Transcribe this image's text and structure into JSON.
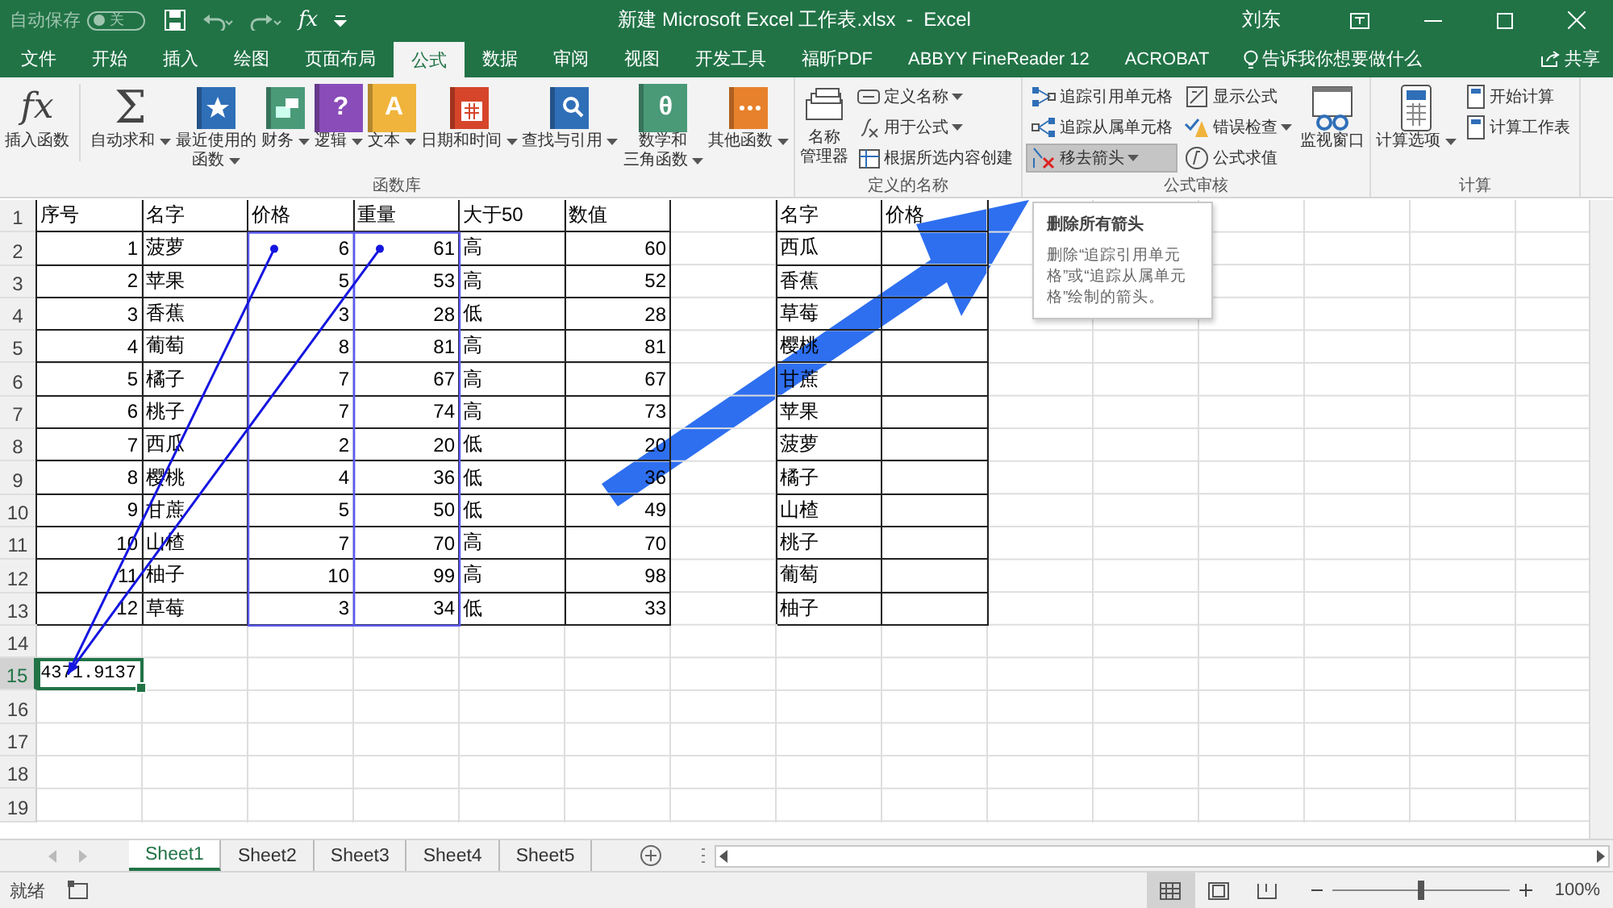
{
  "title_bar": {
    "autosave": {
      "label": "自动保存",
      "on": false,
      "state_label": "关"
    },
    "quick_access_glyph": "fx",
    "title": "新建 Microsoft Excel 工作表.xlsx  -  Excel",
    "user": "刘东"
  },
  "tabs": [
    {
      "label": "文件",
      "selected": false
    },
    {
      "label": "开始",
      "selected": false
    },
    {
      "label": "插入",
      "selected": false
    },
    {
      "label": "绘图",
      "selected": false
    },
    {
      "label": "页面布局",
      "selected": false
    },
    {
      "label": "公式",
      "selected": true
    },
    {
      "label": "数据",
      "selected": false
    },
    {
      "label": "审阅",
      "selected": false
    },
    {
      "label": "视图",
      "selected": false
    },
    {
      "label": "开发工具",
      "selected": false
    },
    {
      "label": "福昕PDF",
      "selected": false
    },
    {
      "label": "ABBYY FineReader 12",
      "selected": false
    },
    {
      "label": "ACROBAT",
      "selected": false
    }
  ],
  "tell_me": "告诉我你想要做什么",
  "share": "共享",
  "ribbon": {
    "function_library": {
      "label": "函数库",
      "buttons": [
        {
          "glyph": "fx",
          "lines": [
            "插入函数"
          ],
          "dropdown": false
        },
        {
          "glyph": "Σ",
          "lines": [
            "自动求和"
          ],
          "dropdown": true
        },
        {
          "lines": [
            "最近使用的",
            "函数"
          ],
          "dropdown": true
        },
        {
          "lines": [
            "财务"
          ],
          "dropdown": true
        },
        {
          "glyph": "?",
          "lines": [
            "逻辑"
          ],
          "dropdown": true
        },
        {
          "glyph": "A",
          "lines": [
            "文本"
          ],
          "dropdown": true
        },
        {
          "lines": [
            "日期和时间"
          ],
          "dropdown": true
        },
        {
          "lines": [
            "查找与引用"
          ],
          "dropdown": true
        },
        {
          "glyph": "θ",
          "lines": [
            "数学和",
            "三角函数"
          ],
          "dropdown": true
        },
        {
          "lines": [
            "其他函数"
          ],
          "dropdown": true
        }
      ]
    },
    "defined_names": {
      "label": "定义的名称",
      "large": {
        "lines": [
          "名称",
          "管理器"
        ]
      },
      "items": [
        {
          "label": "定义名称",
          "dropdown": true
        },
        {
          "label": "用于公式",
          "dropdown": true
        },
        {
          "label": "根据所选内容创建",
          "dropdown": false
        }
      ]
    },
    "formula_auditing": {
      "label": "公式审核",
      "column_1": [
        {
          "label": "追踪引用单元格",
          "dropdown": false,
          "pressed": false
        },
        {
          "label": "追踪从属单元格",
          "dropdown": false,
          "pressed": false
        },
        {
          "label": "移去箭头",
          "dropdown": true,
          "pressed": true
        }
      ],
      "column_2": [
        {
          "label": "显示公式",
          "dropdown": false,
          "pressed": false
        },
        {
          "label": "错误检查",
          "dropdown": true,
          "pressed": false
        },
        {
          "label": "公式求值",
          "dropdown": false,
          "pressed": false
        }
      ],
      "large": {
        "lines": [
          "监视窗口"
        ]
      }
    },
    "calculation": {
      "label": "计算",
      "large": {
        "lines": [
          "计算选项"
        ],
        "dropdown": true
      },
      "items": [
        {
          "label": "开始计算"
        },
        {
          "label": "计算工作表"
        }
      ]
    }
  },
  "sheet": {
    "row_numbers": [
      "1",
      "2",
      "3",
      "4",
      "5",
      "6",
      "7",
      "8",
      "9",
      "10",
      "11",
      "12",
      "13",
      "14",
      "15",
      "16",
      "17",
      "18",
      "19"
    ],
    "table_1": {
      "columns": [
        {
          "header": "序号",
          "kind": "number",
          "traced": false
        },
        {
          "header": "名字",
          "kind": "text",
          "traced": false
        },
        {
          "header": "价格",
          "kind": "number",
          "traced": true
        },
        {
          "header": "重量",
          "kind": "number",
          "traced": true
        },
        {
          "header": "大于50",
          "kind": "text",
          "traced": false
        },
        {
          "header": "数值",
          "kind": "number",
          "traced": false
        }
      ],
      "rows": [
        [
          "1",
          "菠萝",
          "6",
          "61",
          "高",
          "60"
        ],
        [
          "2",
          "苹果",
          "5",
          "53",
          "高",
          "52"
        ],
        [
          "3",
          "香蕉",
          "3",
          "28",
          "低",
          "28"
        ],
        [
          "4",
          "葡萄",
          "8",
          "81",
          "高",
          "81"
        ],
        [
          "5",
          "橘子",
          "7",
          "67",
          "高",
          "67"
        ],
        [
          "6",
          "桃子",
          "7",
          "74",
          "高",
          "73"
        ],
        [
          "7",
          "西瓜",
          "2",
          "20",
          "低",
          "20"
        ],
        [
          "8",
          "樱桃",
          "4",
          "36",
          "低",
          "36"
        ],
        [
          "9",
          "甘蔗",
          "5",
          "50",
          "低",
          "49"
        ],
        [
          "10",
          "山楂",
          "7",
          "70",
          "高",
          "70"
        ],
        [
          "11",
          "柚子",
          "10",
          "99",
          "高",
          "98"
        ],
        [
          "12",
          "草莓",
          "3",
          "34",
          "低",
          "33"
        ]
      ]
    },
    "table_2": {
      "columns": [
        {
          "header": "名字"
        },
        {
          "header": "价格"
        }
      ],
      "rows": [
        [
          "西瓜"
        ],
        [
          "香蕉"
        ],
        [
          "草莓"
        ],
        [
          "樱桃"
        ],
        [
          "甘蔗"
        ],
        [
          "苹果"
        ],
        [
          "菠萝"
        ],
        [
          "橘子"
        ],
        [
          "山楂"
        ],
        [
          "桃子"
        ],
        [
          "葡萄"
        ],
        [
          "柚子"
        ]
      ]
    },
    "result_cell": {
      "value": "4371.9137",
      "selected": true
    }
  },
  "tooltip": {
    "title": "删除所有箭头",
    "body": "删除“追踪引用单元格”或“追踪从属单元格”绘制的箭头。"
  },
  "sheet_tabs": [
    {
      "label": "Sheet1",
      "selected": true
    },
    {
      "label": "Sheet2",
      "selected": false
    },
    {
      "label": "Sheet3",
      "selected": false
    },
    {
      "label": "Sheet4",
      "selected": false
    },
    {
      "label": "Sheet5",
      "selected": false
    }
  ],
  "status_bar": {
    "status": "就绪",
    "views": [
      {
        "selected": true
      },
      {
        "selected": false
      },
      {
        "selected": false
      }
    ],
    "zoom": {
      "level": 0.5,
      "label": "100%"
    }
  }
}
